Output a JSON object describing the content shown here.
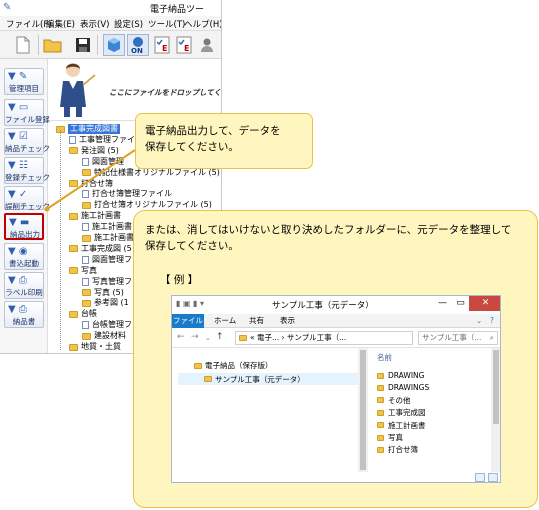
{
  "app": {
    "title": "電子納品ツー",
    "menu": [
      "ファイル(F)",
      "編集(E)",
      "表示(V)",
      "設定(S)",
      "ツール(T)",
      "ヘルプ(H)"
    ],
    "toolbar_icons": [
      "new-document-icon",
      "open-folder-icon",
      "save-icon",
      "cube-icon",
      "on-icon",
      "checklist-icon",
      "checklist-e-icon",
      "person-icon"
    ],
    "sidebar": [
      {
        "label": "管理項目",
        "icon": "edit-icon"
      },
      {
        "label": "ファイル登録",
        "icon": "folder-add-icon"
      },
      {
        "label": "納品チェック",
        "icon": "check-icon"
      },
      {
        "label": "登録チェック",
        "icon": "check-list-icon"
      },
      {
        "label": "誤削チェック",
        "icon": "check-mark-icon"
      },
      {
        "label": "納品出力",
        "icon": "output-icon"
      },
      {
        "label": "書込起動",
        "icon": "disc-write-icon"
      },
      {
        "label": "ラベル印刷",
        "icon": "printer-icon"
      },
      {
        "label": "納品書",
        "icon": "document-print-icon"
      }
    ],
    "drop_text": "ここにファイルをドロップしてください",
    "tree": [
      {
        "label": "工事完成図書",
        "level": 0,
        "type": "folder",
        "selected": true
      },
      {
        "label": "工事管理ファイ",
        "level": 1,
        "type": "file"
      },
      {
        "label": "発注図 (5)",
        "level": 1,
        "type": "folder"
      },
      {
        "label": "図面管理",
        "level": 2,
        "type": "file"
      },
      {
        "label": "特記仕様書オリジナルファイル (5)",
        "level": 2,
        "type": "folder"
      },
      {
        "label": "打合せ簿",
        "level": 1,
        "type": "folder"
      },
      {
        "label": "打合せ簿管理ファイル",
        "level": 2,
        "type": "file"
      },
      {
        "label": "打合せ簿オリジナルファイル (5)",
        "level": 2,
        "type": "folder"
      },
      {
        "label": "施工計画書",
        "level": 1,
        "type": "folder"
      },
      {
        "label": "施工計画書",
        "level": 2,
        "type": "file"
      },
      {
        "label": "施工計画書",
        "level": 2,
        "type": "folder"
      },
      {
        "label": "工事完成図 (5",
        "level": 1,
        "type": "folder"
      },
      {
        "label": "図面管理フ",
        "level": 2,
        "type": "file"
      },
      {
        "label": "写真",
        "level": 1,
        "type": "folder"
      },
      {
        "label": "写真管理フ",
        "level": 2,
        "type": "file"
      },
      {
        "label": "写真 (5)",
        "level": 2,
        "type": "folder"
      },
      {
        "label": "参考図 (1",
        "level": 2,
        "type": "folder"
      },
      {
        "label": "台帳",
        "level": 1,
        "type": "folder"
      },
      {
        "label": "台帳管理フ",
        "level": 2,
        "type": "file"
      },
      {
        "label": "建設材料",
        "level": 2,
        "type": "folder"
      },
      {
        "label": "地質・土質",
        "level": 1,
        "type": "folder"
      }
    ]
  },
  "callout1": {
    "lines": [
      "電子納品出力して、データを",
      "保存してください。"
    ]
  },
  "callout2": {
    "lines": [
      "または、消してはいけないと取り決めしたフォルダーに、元データを整理して",
      "保存してください。"
    ],
    "example_label": "【 例 】"
  },
  "explorer": {
    "title": "サンプル工事（元データ）",
    "tabs": [
      "ファイル",
      "ホーム",
      "共有",
      "表示"
    ],
    "address": "« 電子... › サンプル工事（...",
    "search_placeholder": "サンプル工事（...",
    "nav_tree": [
      {
        "label": "電子納品（保存版）",
        "level": 0
      },
      {
        "label": "サンプル工事（元データ）",
        "level": 1,
        "selected": true
      }
    ],
    "column_header": "名前",
    "files": [
      "DRAWING",
      "DRAWINGS",
      "その他",
      "工事完成図",
      "施工計画書",
      "写真",
      "打合せ簿"
    ]
  }
}
